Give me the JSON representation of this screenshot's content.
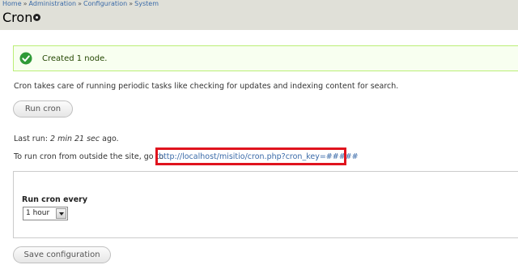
{
  "breadcrumb": {
    "items": [
      "Home",
      "Administration",
      "Configuration",
      "System"
    ],
    "separator": "»"
  },
  "page": {
    "title": "Cron",
    "shortcut_icon": "shortcut-add-icon"
  },
  "message": {
    "icon": "check-circle-icon",
    "text": "Created 1 node."
  },
  "description": "Cron takes care of running periodic tasks like checking for updates and indexing content for search.",
  "run_button": "Run cron",
  "last_run": {
    "label": "Last run:",
    "value": "2 min 21 sec",
    "suffix": "ago."
  },
  "outside": {
    "text": "To run cron from outside the site, go to",
    "link": "http://localhost/misitio/cron.php?cron_key=#####"
  },
  "settings": {
    "field_label": "Run cron every",
    "selected": "1 hour"
  },
  "save_button": "Save configuration",
  "colors": {
    "header_bg": "#e0e0d8",
    "message_bg": "#f8fff0",
    "message_border": "#bbee77",
    "link": "#3a6aa8",
    "highlight": "#e0141e",
    "check": "#2f9a37"
  }
}
